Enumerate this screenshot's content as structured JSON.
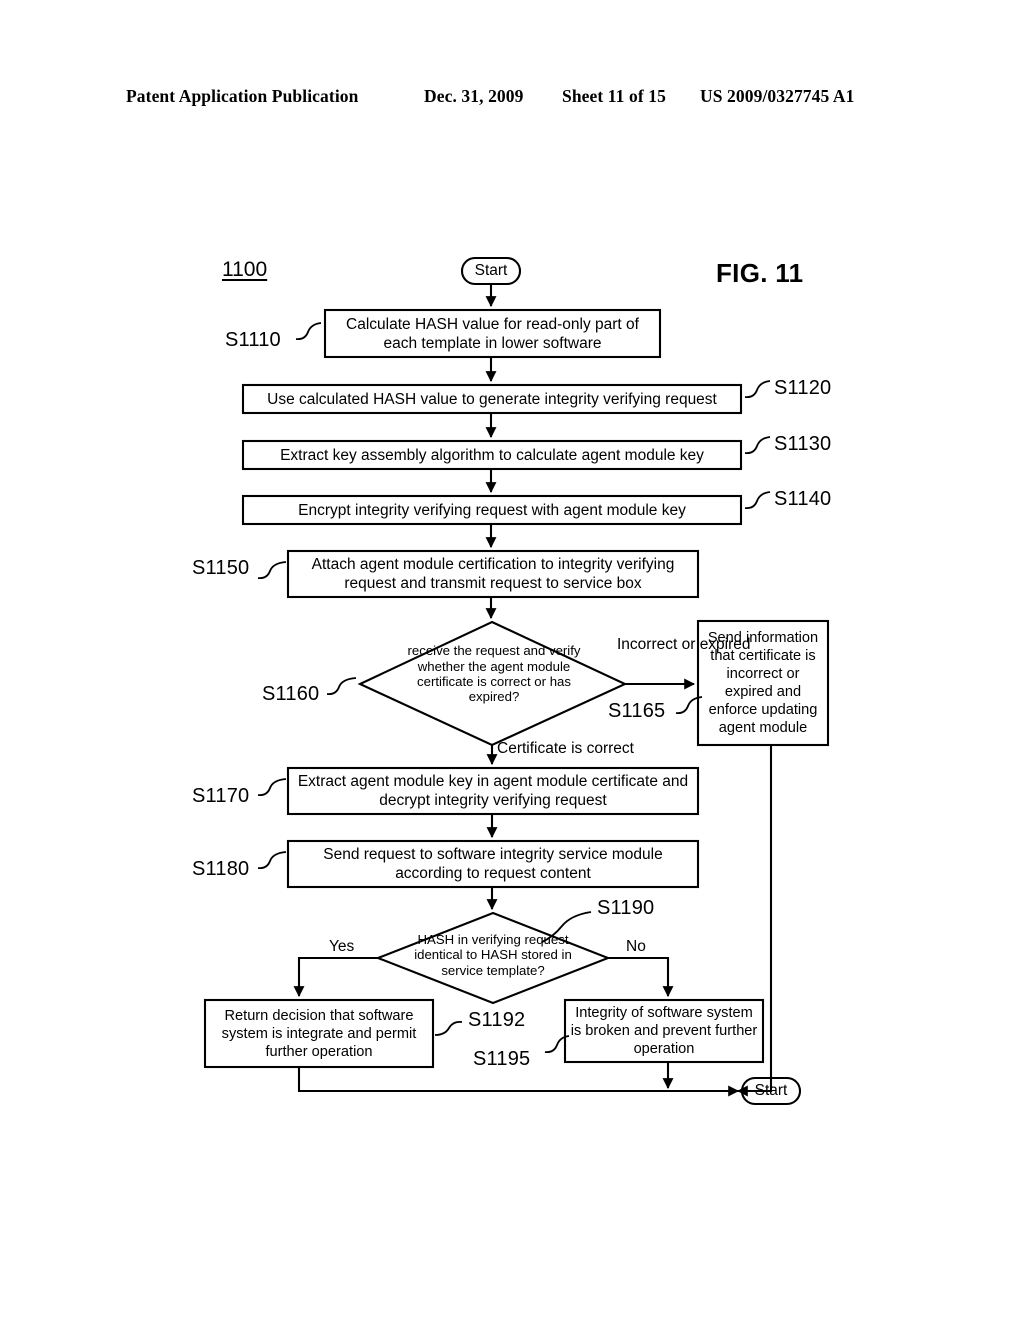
{
  "header": {
    "publication": "Patent Application Publication",
    "date": "Dec. 31, 2009",
    "sheet": "Sheet 11 of 15",
    "patent_number": "US 2009/0327745 A1"
  },
  "figure": {
    "label": "FIG. 11",
    "reference_numeral": "1100"
  },
  "nodes": {
    "start_top": "Start",
    "start_bottom": "Start",
    "s1110": "Calculate HASH value for read-only part of each template in lower software",
    "s1120": "Use calculated HASH value to generate integrity verifying request",
    "s1130": "Extract key assembly algorithm to calculate agent module key",
    "s1140": "Encrypt integrity verifying request with agent module key",
    "s1150": "Attach agent module certification to integrity verifying request and transmit request to service box",
    "s1160": "receive the request and verify whether the agent module certificate is correct or has expired?",
    "s1165": "Send information that certificate is incorrect or expired and enforce updating agent module",
    "s1170": "Extract agent module key in agent module certificate and decrypt integrity verifying request",
    "s1180": "Send request to software integrity service module according to request content",
    "s1190": "HASH in verifying request identical to HASH stored in service template?",
    "s1192": "Return decision that software system is integrate and permit further operation",
    "s1195": "Integrity of software system is broken and prevent further operation"
  },
  "step_refs": {
    "s1110": "S1110",
    "s1120": "S1120",
    "s1130": "S1130",
    "s1140": "S1140",
    "s1150": "S1150",
    "s1160": "S1160",
    "s1165": "S1165",
    "s1170": "S1170",
    "s1180": "S1180",
    "s1190": "S1190",
    "s1192": "S1192",
    "s1195": "S1195"
  },
  "edge_labels": {
    "incorrect_or_expired": "Incorrect or expired",
    "certificate_is_correct": "Certificate is correct",
    "yes": "Yes",
    "no": "No"
  },
  "colors": {
    "stroke": "#000000",
    "background": "#ffffff"
  }
}
